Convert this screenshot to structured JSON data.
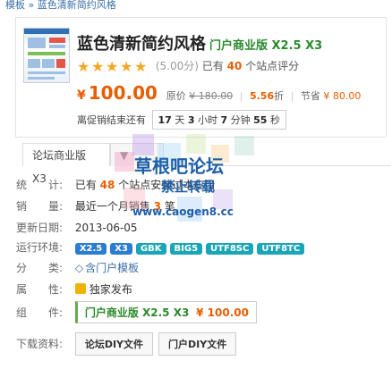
{
  "breadcrumb": {
    "parent": "模板",
    "separator": "»",
    "current": "蓝色清新简约风格"
  },
  "product": {
    "title": "蓝色清新简约风格",
    "edition": "门户商业版 X2.5 X3",
    "rating": {
      "stars": 5,
      "score_text": "(5.00分)",
      "prefix": "已有",
      "count": "40",
      "suffix": "个站点评分"
    },
    "price": {
      "currency": "¥",
      "amount": "100.00"
    },
    "original_label": "原价",
    "original_price": "¥ 180.00",
    "discount": "5.56",
    "discount_unit": "折",
    "save_label": "节省",
    "save_amount": "¥ 80.00",
    "countdown": {
      "label": "离促销结束还有",
      "days": "17",
      "days_unit": "天",
      "hours": "3",
      "hours_unit": "小时",
      "minutes": "7",
      "minutes_unit": "分钟",
      "seconds": "55",
      "seconds_unit": "秒"
    }
  },
  "tabs": {
    "tab1": "论坛商业版 X3",
    "tab2": ""
  },
  "info": {
    "stats_label": "统　　计:",
    "stats_prefix": "已有",
    "stats_count": "48",
    "stats_suffix": "个站点安装过本应用",
    "sales_label": "销　　量:",
    "sales_prefix": "最近一个月销售",
    "sales_count": "3",
    "sales_suffix": "笔",
    "updated_label": "更新日期:",
    "updated_value": "2013-06-05",
    "env_label": "运行环境:",
    "env": [
      "X2.5",
      "X3",
      "GBK",
      "BIG5",
      "UTF8SC",
      "UTF8TC"
    ],
    "category_label": "分　　类:",
    "category_value": "含门户模板",
    "attribute_label": "属　　性:",
    "attribute_value": "独家发布",
    "component_label": "组　　件:",
    "component_name": "门户商业版 X2.5 X3",
    "component_price": "¥ 100.00",
    "download_label": "下载资料:",
    "download_btn1": "论坛DIY文件",
    "download_btn2": "门户DIY文件"
  },
  "watermark": {
    "line1": "草根吧论坛",
    "line2": "禁止转载",
    "line3": "www.caogen8.cc"
  },
  "colors": {
    "accent": "#e85d00",
    "link": "#3a6ea5",
    "edition": "#2b8a2b",
    "env_blue": "#2b7cd3",
    "env_teal": "#1aa6b7",
    "star": "#f5a623"
  }
}
